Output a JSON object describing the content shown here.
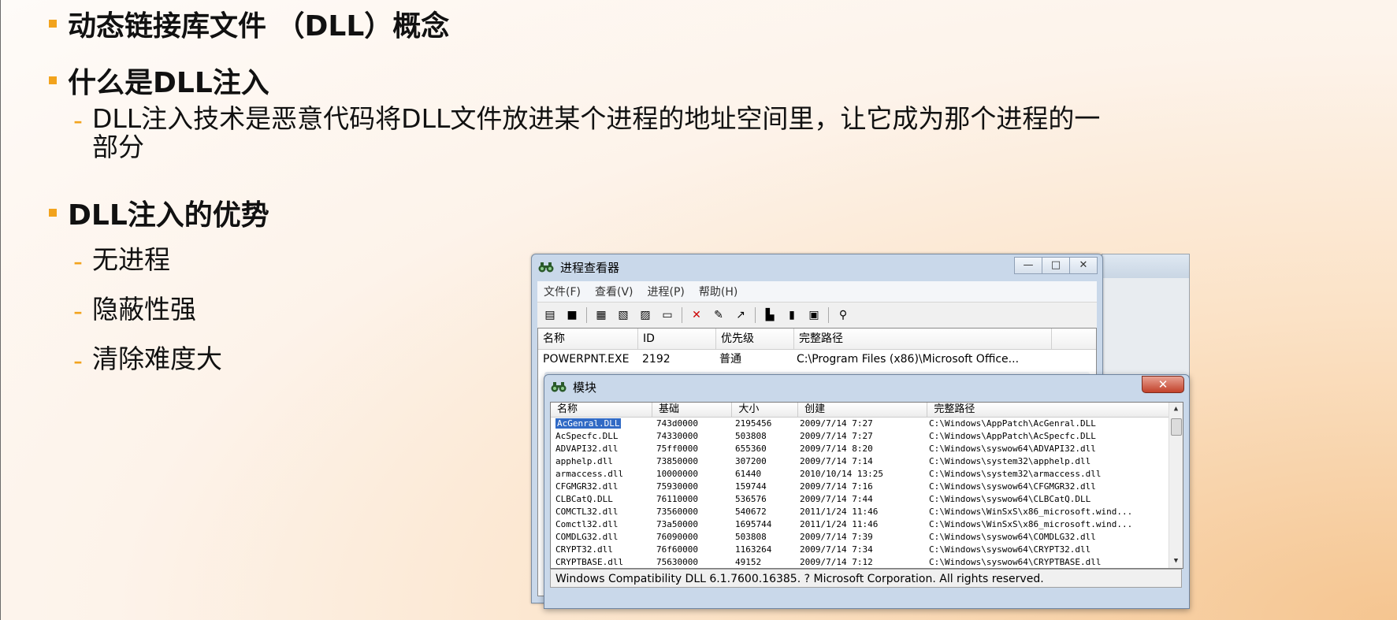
{
  "slide": {
    "b1": "动态链接库文件 （DLL）概念",
    "b2": "什么是DLL注入",
    "b2_sub": "DLL注入技术是恶意代码将DLL文件放进某个进程的地址空间里，让它成为那个进程的一",
    "b2_sub2": "部分",
    "b3": "DLL注入的优势",
    "advantages": [
      "无进程",
      "隐蔽性强",
      "清除难度大"
    ],
    "dash": "-",
    "accent_color": "#f2a31d"
  },
  "main_window": {
    "title": "进程查看器",
    "icon": "binoculars-icon",
    "btn_min": "—",
    "btn_max": "□",
    "btn_close": "✕",
    "menu": [
      "文件(F)",
      "查看(V)",
      "进程(P)",
      "帮助(H)"
    ],
    "toolbar": {
      "new": "▤",
      "save": "■",
      "t3": "▦",
      "t4": "▧",
      "t5": "▨",
      "t6": "▭",
      "delete": "✕",
      "t8": "✎",
      "t9": "↗",
      "t10": "▙",
      "t11": "▮",
      "t12": "▣",
      "find": "⚲"
    },
    "columns": [
      "名称",
      "ID",
      "优先级",
      "完整路径"
    ],
    "process": {
      "name": "POWERPNT.EXE",
      "id": "2192",
      "priority": "普通",
      "path": "C:\\Program Files (x86)\\Microsoft Office..."
    }
  },
  "module_window": {
    "title": "模块",
    "icon": "binoculars-icon",
    "close": "✕",
    "columns": [
      "名称",
      "基础",
      "大小",
      "创建",
      "完整路径"
    ],
    "rows": [
      [
        "AcGenral.DLL",
        "743d0000",
        "2195456",
        "2009/7/14 7:27",
        "C:\\Windows\\AppPatch\\AcGenral.DLL"
      ],
      [
        "AcSpecfc.DLL",
        "74330000",
        "503808",
        "2009/7/14 7:27",
        "C:\\Windows\\AppPatch\\AcSpecfc.DLL"
      ],
      [
        "ADVAPI32.dll",
        "75ff0000",
        "655360",
        "2009/7/14 8:20",
        "C:\\Windows\\syswow64\\ADVAPI32.dll"
      ],
      [
        "apphelp.dll",
        "73850000",
        "307200",
        "2009/7/14 7:14",
        "C:\\Windows\\system32\\apphelp.dll"
      ],
      [
        "armaccess.dll",
        "10000000",
        "61440",
        "2010/10/14 13:25",
        "C:\\Windows\\system32\\armaccess.dll"
      ],
      [
        "CFGMGR32.dll",
        "75930000",
        "159744",
        "2009/7/14 7:16",
        "C:\\Windows\\syswow64\\CFGMGR32.dll"
      ],
      [
        "CLBCatQ.DLL",
        "76110000",
        "536576",
        "2009/7/14 7:44",
        "C:\\Windows\\syswow64\\CLBCatQ.DLL"
      ],
      [
        "COMCTL32.dll",
        "73560000",
        "540672",
        "2011/1/24 11:46",
        "C:\\Windows\\WinSxS\\x86_microsoft.wind..."
      ],
      [
        "Comctl32.dll",
        "73a50000",
        "1695744",
        "2011/1/24 11:46",
        "C:\\Windows\\WinSxS\\x86_microsoft.wind..."
      ],
      [
        "COMDLG32.dll",
        "76090000",
        "503808",
        "2009/7/14 7:39",
        "C:\\Windows\\syswow64\\COMDLG32.dll"
      ],
      [
        "CRYPT32.dll",
        "76f60000",
        "1163264",
        "2009/7/14 7:34",
        "C:\\Windows\\syswow64\\CRYPT32.dll"
      ],
      [
        "CRYPTBASE.dll",
        "75630000",
        "49152",
        "2009/7/14 7:12",
        "C:\\Windows\\syswow64\\CRYPTBASE.dll"
      ]
    ],
    "status": "Windows Compatibility DLL 6.1.7600.16385. ? Microsoft Corporation. All rights reserved."
  }
}
